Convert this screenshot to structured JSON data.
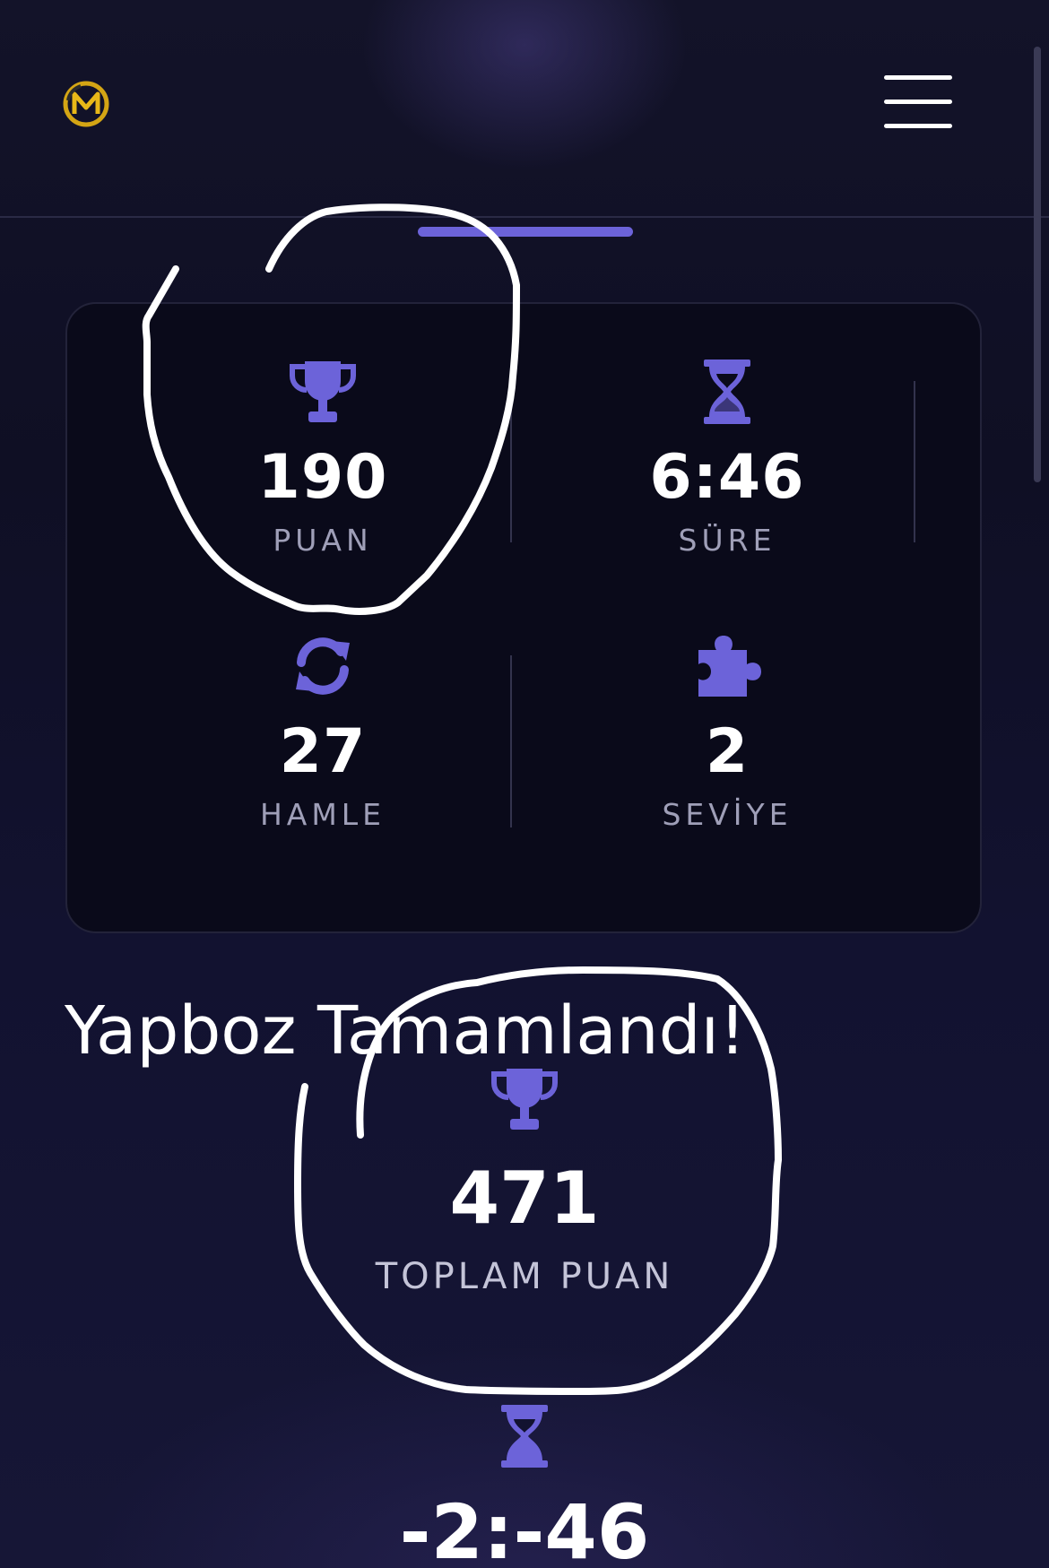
{
  "header": {
    "logo_icon": "m-logo-icon",
    "menu_icon": "hamburger-menu-icon"
  },
  "colors": {
    "accent": "#6c63d9",
    "background": "#0f0f24",
    "card": "#0a0a1a",
    "logo_gold": "#d4a514",
    "annotation": "#ffffff"
  },
  "stats": [
    {
      "icon": "trophy-icon",
      "value": "190",
      "label": "PUAN"
    },
    {
      "icon": "hourglass-icon",
      "value": "6:46",
      "label": "SÜRE"
    },
    {
      "icon": "rotate-icon",
      "value": "27",
      "label": "HAMLE"
    },
    {
      "icon": "puzzle-icon",
      "value": "2",
      "label": "SEVİYE"
    }
  ],
  "result": {
    "title": "Yapboz Tamamlandı!",
    "total_icon": "trophy-icon",
    "total_value": "471",
    "total_label": "TOPLAM PUAN",
    "time_icon": "hourglass-icon",
    "time_value": "-2:-46"
  }
}
